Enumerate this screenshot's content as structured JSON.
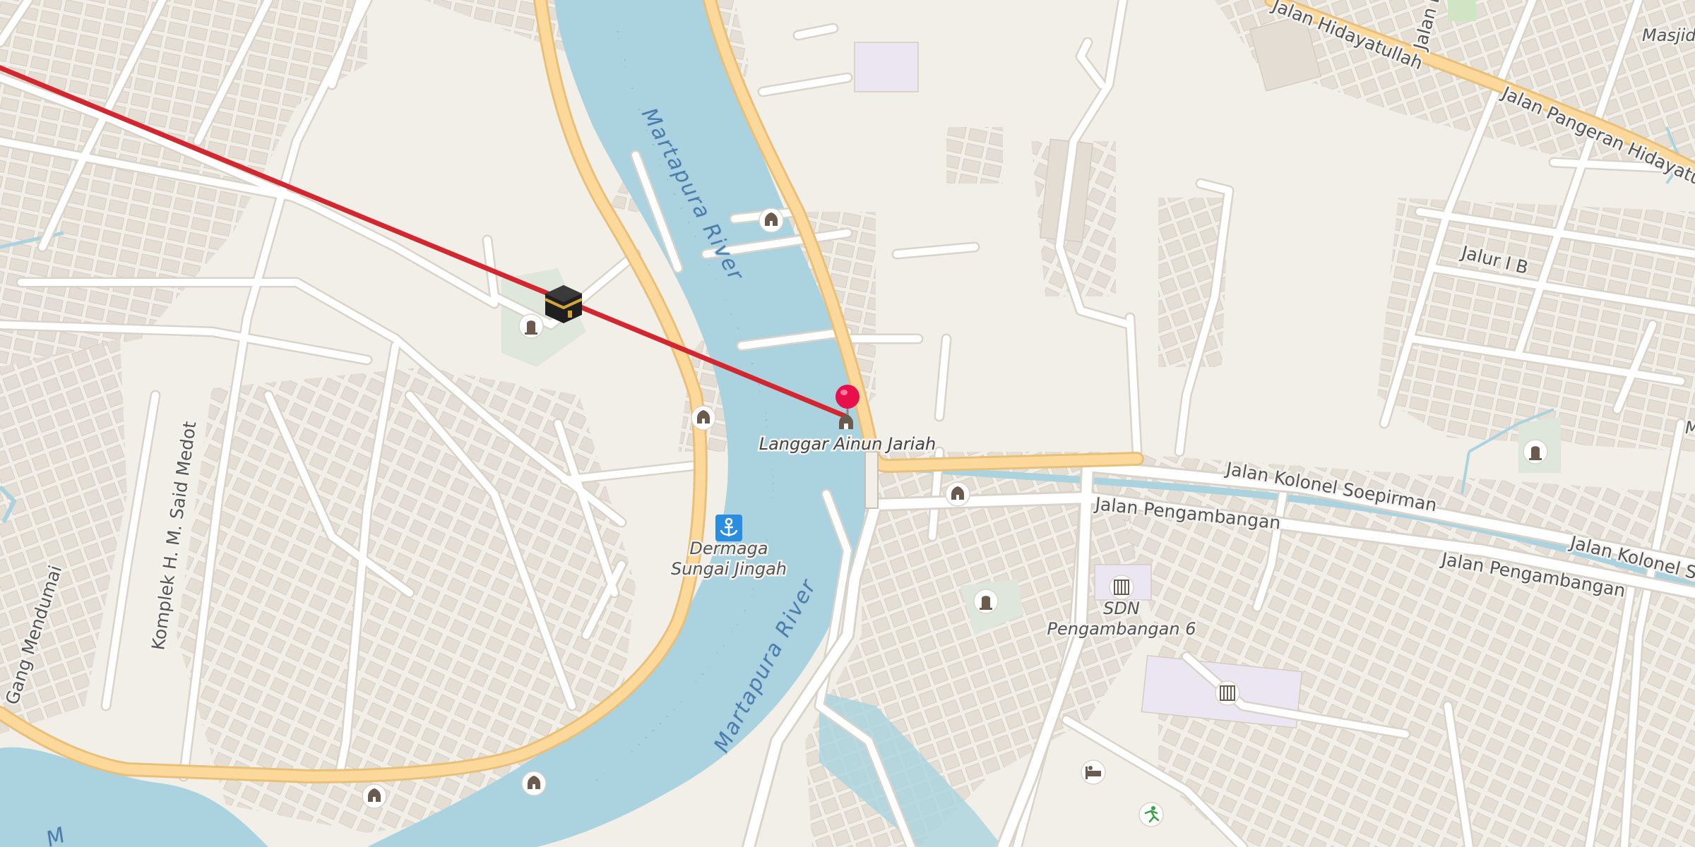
{
  "map": {
    "colors": {
      "land": "#f2efe9",
      "building": "#e3ddd4",
      "building_edge": "#d4ccc1",
      "water": "#aad3df",
      "major_road": "#fcd89a",
      "major_road_edge": "#e8c07a",
      "minor_road": "#ffffff",
      "minor_road_edge": "#d9d3ca",
      "park": "#dfe6dc",
      "qibla_line": "#d3262e",
      "pin": "#e8104a"
    },
    "roads": {
      "jalan_hidayatullah": "Jalan Hidayatullah",
      "jalan_pangeran_hidayatullah": "Jalan Pangeran Hidayatullah",
      "jalan_l": "Jalan L",
      "jalur_1b": "Jalur I B",
      "jalan_kolonel_soepirman_1": "Jalan Kolonel Soepirman",
      "jalan_kolonel_soepirman_2": "Jalan Kolonel So",
      "jalan_pengambangan_1": "Jalan Pengambangan",
      "jalan_pengambangan_2": "Jalan Pengambangan",
      "komplek_said_medot": "Komplek H. M. Said Medot",
      "gang_mendumai": "Gang Mendumai"
    },
    "water_labels": {
      "river_north": "Martapura River",
      "river_south": "Martapura River",
      "river_corner": "M"
    },
    "pois": {
      "masjid": "Masjid",
      "langgar": "Langgar Ainun Jariah",
      "dermaga_line1": "Dermaga",
      "dermaga_line2": "Sungai Jingah",
      "sdn_line1": "SDN",
      "sdn_line2": "Pengambangan 6",
      "edge_m": "M"
    },
    "icons": {
      "kaaba": "kaaba-icon",
      "pin": "location-pin-icon",
      "mosque": "mosque-icon",
      "cemetery": "cemetery-icon",
      "anchor": "anchor-icon",
      "school": "school-icon",
      "hotel": "bed-icon",
      "sport": "running-icon"
    }
  }
}
